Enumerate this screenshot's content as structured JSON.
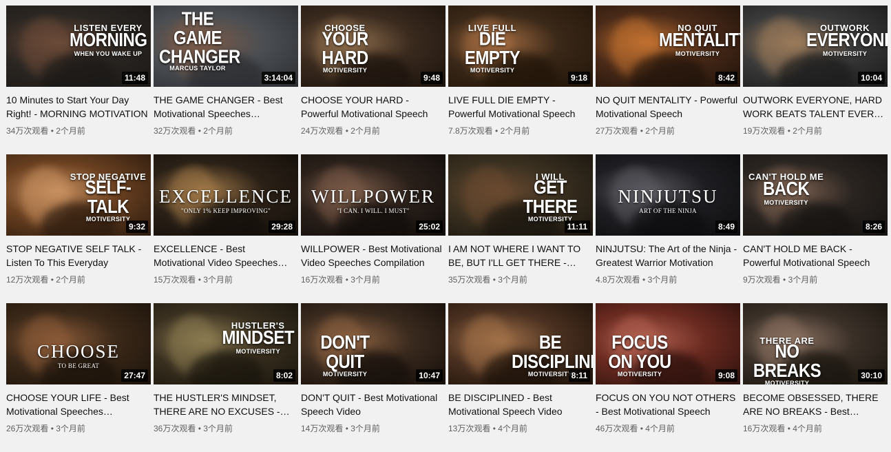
{
  "videos": [
    {
      "title": "10 Minutes to Start Your Day Right! - MORNING MOTIVATION",
      "duration": "11:48",
      "views": "34万次观看",
      "age": "2个月前",
      "overlay": {
        "l1": "LISTEN EVERY",
        "l2": "MORNING",
        "l3": "WHEN YOU WAKE UP"
      },
      "colors": {
        "bg": "#2b2622",
        "a": "#6b4a38",
        "b": "#1a1816"
      }
    },
    {
      "title": "THE GAME CHANGER - Best Motivational Speeches Compilation",
      "duration": "3:14:04",
      "views": "32万次观看",
      "age": "2个月前",
      "overlay": {
        "l1": "",
        "l2": "THE GAME CHANGER",
        "l3": "MARCUS TAYLOR"
      },
      "colors": {
        "bg": "#4b4e52",
        "a": "#7a5a48",
        "b": "#2a2c30"
      }
    },
    {
      "title": "CHOOSE YOUR HARD - Powerful Motivational Speech",
      "duration": "9:48",
      "views": "24万次观看",
      "age": "2个月前",
      "overlay": {
        "l1": "CHOOSE",
        "l2": "YOUR HARD",
        "l3": "MOTIVERSITY"
      },
      "colors": {
        "bg": "#3a2a1e",
        "a": "#8a6a4a",
        "b": "#1a120c"
      }
    },
    {
      "title": "LIVE FULL DIE EMPTY - Powerful Motivational Speech",
      "duration": "9:18",
      "views": "7.8万次观看",
      "age": "2个月前",
      "overlay": {
        "l1": "LIVE FULL",
        "l2": "DIE EMPTY",
        "l3": "MOTIVERSITY"
      },
      "colors": {
        "bg": "#3a2818",
        "a": "#a06a40",
        "b": "#201408"
      }
    },
    {
      "title": "NO QUIT MENTALITY - Powerful Motivational Speech",
      "duration": "8:42",
      "views": "27万次观看",
      "age": "2个月前",
      "overlay": {
        "l1": "NO QUIT",
        "l2": "MENTALITY",
        "l3": "MOTIVERSITY"
      },
      "colors": {
        "bg": "#4a2a18",
        "a": "#c07030",
        "b": "#1e120a"
      }
    },
    {
      "title": "OUTWORK EVERYONE, HARD WORK BEATS TALENT EVERY TIME",
      "duration": "10:04",
      "views": "19万次观看",
      "age": "2个月前",
      "overlay": {
        "l1": "OUTWORK",
        "l2": "EVERYONE",
        "l3": "MOTIVERSITY"
      },
      "colors": {
        "bg": "#3a3a3a",
        "a": "#9a7a5a",
        "b": "#1a1a1a"
      }
    },
    {
      "title": "STOP NEGATIVE SELF TALK - Listen To This Everyday",
      "duration": "9:32",
      "views": "12万次观看",
      "age": "2个月前",
      "overlay": {
        "l1": "STOP NEGATIVE",
        "l2": "SELF-TALK",
        "l3": "MOTIVERSITY"
      },
      "colors": {
        "bg": "#6a4020",
        "a": "#c89060",
        "b": "#2a1a0e"
      }
    },
    {
      "title": "EXCELLENCE - Best Motivational Video Speeches Compilation",
      "duration": "29:28",
      "views": "15万次观看",
      "age": "3个月前",
      "overlay": {
        "l1": "",
        "l2": "EXCELLENCE",
        "l3": "\"ONLY 1% KEEP IMPROVING\""
      },
      "colors": {
        "bg": "#2a2016",
        "a": "#a07848",
        "b": "#120e0a"
      }
    },
    {
      "title": "WILLPOWER - Best Motivational Video Speeches Compilation",
      "duration": "25:02",
      "views": "16万次观看",
      "age": "3个月前",
      "overlay": {
        "l1": "",
        "l2": "WILLPOWER",
        "l3": "\"I CAN. I WILL. I MUST\""
      },
      "colors": {
        "bg": "#2a201a",
        "a": "#7a5a48",
        "b": "#100c0a"
      }
    },
    {
      "title": "I AM NOT WHERE I WANT TO BE, BUT I'LL GET THERE - Motivational Speech",
      "duration": "11:11",
      "views": "35万次观看",
      "age": "3个月前",
      "overlay": {
        "l1": "I WILL",
        "l2": "GET THERE",
        "l3": "MOTIVERSITY"
      },
      "colors": {
        "bg": "#3a3020",
        "a": "#6a4a30",
        "b": "#18140e"
      }
    },
    {
      "title": "NINJUTSU: The Art of the Ninja - Greatest Warrior Motivation",
      "duration": "8:49",
      "views": "4.8万次观看",
      "age": "3个月前",
      "overlay": {
        "l1": "",
        "l2": "NINJUTSU",
        "l3": "ART OF THE NINJA"
      },
      "colors": {
        "bg": "#1e1e22",
        "a": "#5a5a60",
        "b": "#0c0c0e"
      }
    },
    {
      "title": "CAN'T HOLD ME BACK - Powerful Motivational Speech",
      "duration": "8:26",
      "views": "9万次观看",
      "age": "3个月前",
      "overlay": {
        "l1": "CAN'T HOLD ME",
        "l2": "BACK",
        "l3": "MOTIVERSITY"
      },
      "colors": {
        "bg": "#2a2420",
        "a": "#7a6050",
        "b": "#141210"
      }
    },
    {
      "title": "CHOOSE YOUR LIFE - Best Motivational Speeches Compilation",
      "duration": "27:47",
      "views": "26万次观看",
      "age": "3个月前",
      "overlay": {
        "l1": "",
        "l2": "CHOOSE",
        "l3": "TO BE GREAT"
      },
      "colors": {
        "bg": "#3a2818",
        "a": "#8a5a38",
        "b": "#1a120a"
      }
    },
    {
      "title": "THE HUSTLER'S MINDSET, THERE ARE NO EXCUSES - Motivational Speech",
      "duration": "8:02",
      "views": "36万次观看",
      "age": "3个月前",
      "overlay": {
        "l1": "HUSTLER'S",
        "l2": "MINDSET",
        "l3": "MOTIVERSITY"
      },
      "colors": {
        "bg": "#3a3020",
        "a": "#8a7a50",
        "b": "#18140c"
      }
    },
    {
      "title": "DON'T QUIT - Best Motivational Speech Video",
      "duration": "10:47",
      "views": "14万次观看",
      "age": "3个月前",
      "overlay": {
        "l1": "",
        "l2": "DON'T QUIT",
        "l3": "MOTIVERSITY"
      },
      "colors": {
        "bg": "#3a2a1e",
        "a": "#8a6040",
        "b": "#140e0a"
      }
    },
    {
      "title": "BE DISCIPLINED - Best Motivational Speech Video",
      "duration": "8:11",
      "views": "13万次观看",
      "age": "4个月前",
      "overlay": {
        "l1": "",
        "l2": "BE DISCIPLINED",
        "l3": "MOTIVERSITY"
      },
      "colors": {
        "bg": "#4a3020",
        "a": "#a07048",
        "b": "#1a1008"
      }
    },
    {
      "title": "FOCUS ON YOU NOT OTHERS - Best Motivational Speech",
      "duration": "9:08",
      "views": "46万次观看",
      "age": "4个月前",
      "overlay": {
        "l1": "",
        "l2": "FOCUS ON YOU",
        "l3": "MOTIVERSITY"
      },
      "colors": {
        "bg": "#6a2a20",
        "a": "#b06050",
        "b": "#2a100c"
      }
    },
    {
      "title": "BECOME OBSESSED, THERE ARE NO BREAKS - Best Motivational Speech",
      "duration": "30:10",
      "views": "16万次观看",
      "age": "4个月前",
      "overlay": {
        "l1": "THERE ARE",
        "l2": "NO BREAKS",
        "l3": "MOTIVERSITY"
      },
      "colors": {
        "bg": "#3a3028",
        "a": "#8a7060",
        "b": "#18140e"
      }
    }
  ]
}
